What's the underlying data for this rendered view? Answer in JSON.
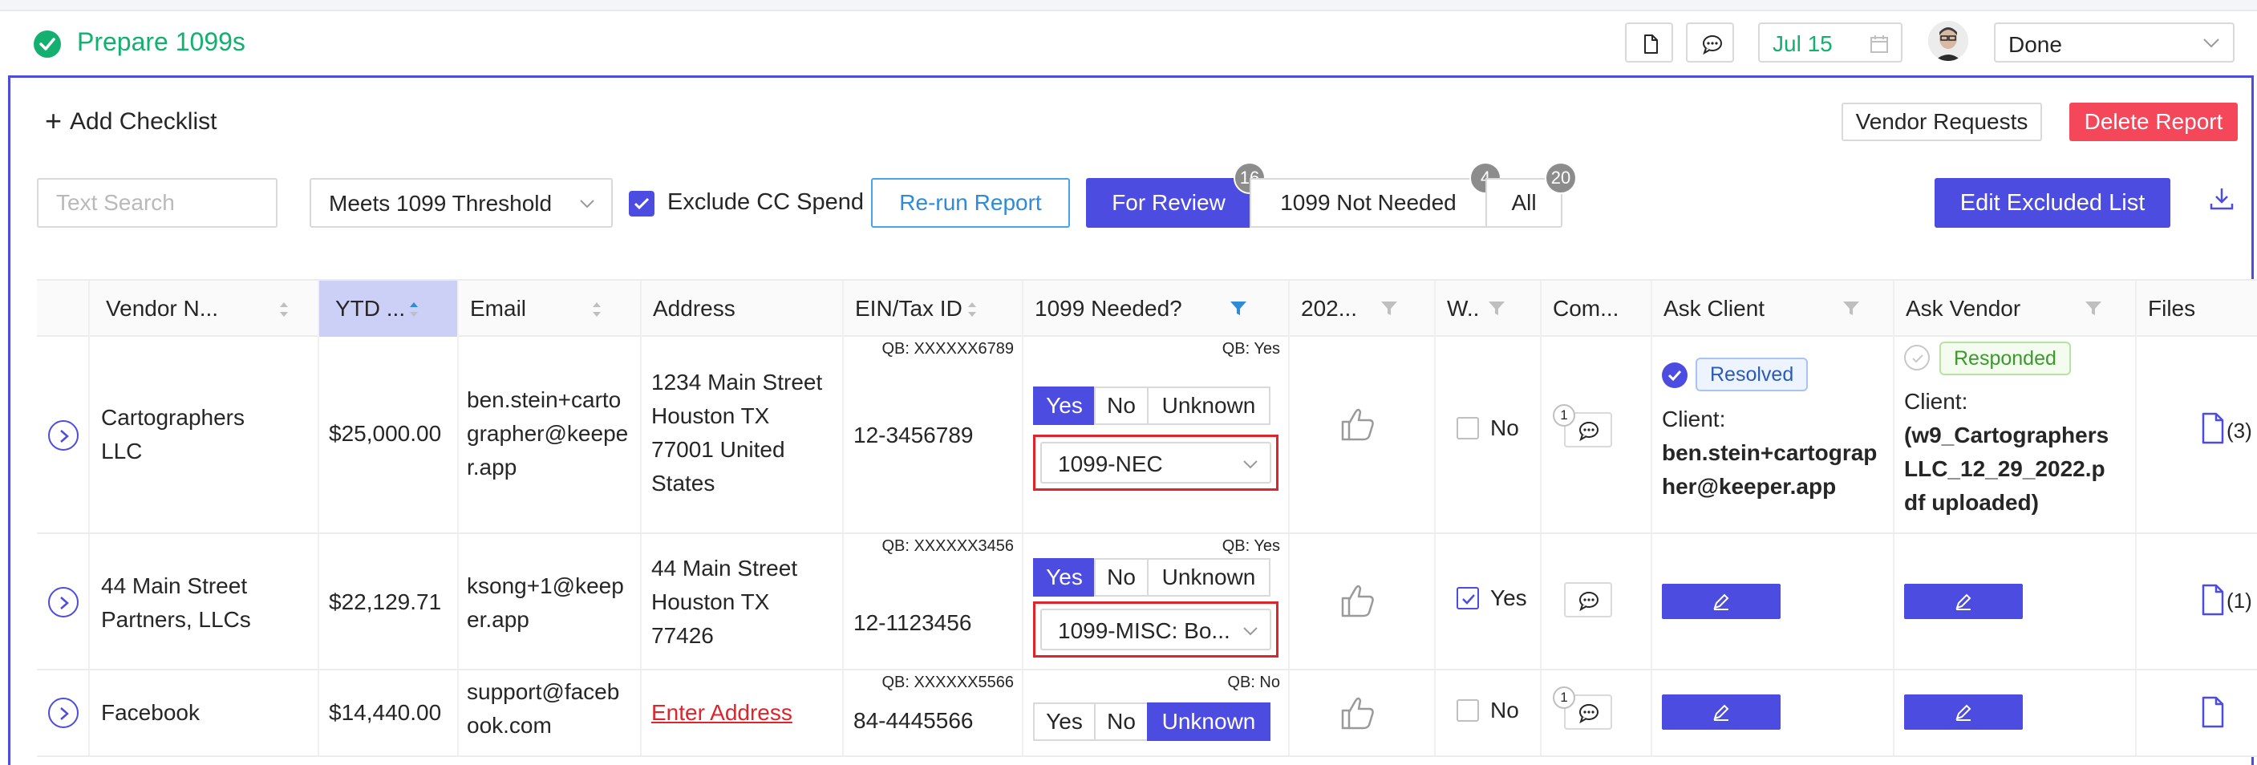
{
  "header": {
    "task_title": "Prepare 1099s",
    "date": "Jul 15",
    "status": "Done"
  },
  "toolbar": {
    "add_checklist": "Add Checklist",
    "vendor_requests": "Vendor Requests",
    "delete_report": "Delete Report",
    "search_placeholder": "Text Search",
    "filter_value": "Meets 1099 Threshold",
    "exclude_cc_label": "Exclude CC Spend",
    "exclude_cc_checked": true,
    "rerun_report": "Re-run Report",
    "tabs": [
      {
        "label": "For Review",
        "count": "16",
        "active": true
      },
      {
        "label": "1099 Not Needed",
        "count": "4",
        "active": false
      },
      {
        "label": "All",
        "count": "20",
        "active": false
      }
    ],
    "edit_excluded": "Edit Excluded List"
  },
  "table": {
    "columns": [
      "Vendor N...",
      "YTD ...",
      "Email",
      "Address",
      "EIN/Tax ID",
      "1099 Needed?",
      "202...",
      "W..",
      "Com...",
      "Ask Client",
      "Ask Vendor",
      "Files"
    ],
    "rows": [
      {
        "vendor": [
          "Cartographers",
          "LLC"
        ],
        "ytd": "$25,000.00",
        "email": [
          "ben.stein+carto",
          "grapher@keepe",
          "r.app"
        ],
        "address": [
          "1234 Main Street",
          "Houston TX",
          "77001 United",
          "States"
        ],
        "qb_ein": "QB: XXXXXX6789",
        "ein": "12-3456789",
        "qb_needed": "QB: Yes",
        "needed": "Yes",
        "form": "1099-NEC",
        "w9": "No",
        "w9_checked": false,
        "comments": "1",
        "ask_client_tag": "Resolved",
        "ask_client_text": [
          "Client:",
          "ben.stein+cartograp",
          "her@keeper.app"
        ],
        "ask_vendor_tag": "Responded",
        "ask_vendor_text": [
          "Client:",
          "(w9_Cartographers",
          "LLC_12_29_2022.p",
          "df uploaded)"
        ],
        "files": "(3)"
      },
      {
        "vendor": [
          "44 Main Street",
          "Partners, LLCs"
        ],
        "ytd": "$22,129.71",
        "email": [
          "ksong+1@keep",
          "er.app"
        ],
        "address": [
          "44 Main Street",
          "Houston TX",
          "77426"
        ],
        "qb_ein": "QB: XXXXXX3456",
        "ein": "12-1123456",
        "qb_needed": "QB: Yes",
        "needed": "Yes",
        "form": "1099-MISC: Bo...",
        "w9": "Yes",
        "w9_checked": true,
        "comments": "",
        "files": "(1)"
      },
      {
        "vendor": [
          "Facebook"
        ],
        "ytd": "$14,440.00",
        "email": [
          "support@faceb",
          "ook.com"
        ],
        "address_link": "Enter Address",
        "qb_ein": "QB: XXXXXX5566",
        "ein": "84-4445566",
        "qb_needed": "QB: No",
        "needed": "Unknown",
        "w9": "No",
        "w9_checked": false,
        "comments": "1",
        "files": ""
      }
    ],
    "yn_options": [
      "Yes",
      "No",
      "Unknown"
    ]
  },
  "colors": {
    "accent": "#4c4de0",
    "success": "#13b06f",
    "danger": "#f5475a",
    "highlight_border": "#e0242b"
  }
}
